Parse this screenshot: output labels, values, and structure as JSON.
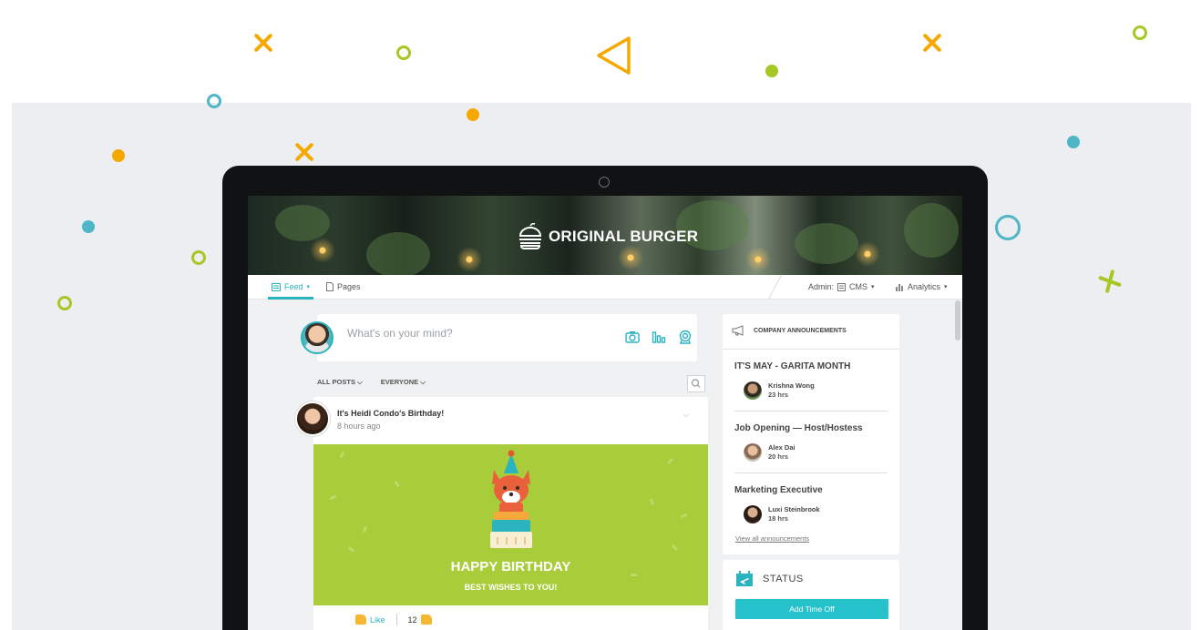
{
  "brand": {
    "name": "ORIGINAL BURGER"
  },
  "nav": {
    "feed": "Feed",
    "pages": "Pages",
    "admin_prefix": "Admin:",
    "cms": "CMS",
    "analytics": "Analytics"
  },
  "composer": {
    "placeholder": "What's on your mind?"
  },
  "filters": {
    "posts": "ALL POSTS",
    "audience": "EVERYONE"
  },
  "post": {
    "title": "It's Heidi Condo's Birthday!",
    "time": "8 hours ago",
    "banner_title": "HAPPY BIRTHDAY",
    "banner_subtitle": "BEST WISHES TO YOU!",
    "like_label": "Like",
    "like_count": "12"
  },
  "announcements": {
    "heading": "COMPANY ANNOUNCEMENTS",
    "items": [
      {
        "title": "IT'S MAY - GARITA MONTH",
        "author": "Krishna Wong",
        "time": "23 hrs"
      },
      {
        "title": "Job Opening — Host/Hostess",
        "author": "Alex Dai",
        "time": "20 hrs"
      },
      {
        "title": "Marketing Executive",
        "author": "Luxi Steinbrook",
        "time": "18 hrs"
      }
    ],
    "view_all": "View all announcements"
  },
  "status": {
    "heading": "STATUS",
    "add_time_off": "Add Time Off"
  },
  "colors": {
    "accent": "#2bb3c0",
    "banner_green": "#a9cd3a",
    "orange": "#f5a900",
    "lime": "#a5c825",
    "teal": "#4fb6c8"
  }
}
